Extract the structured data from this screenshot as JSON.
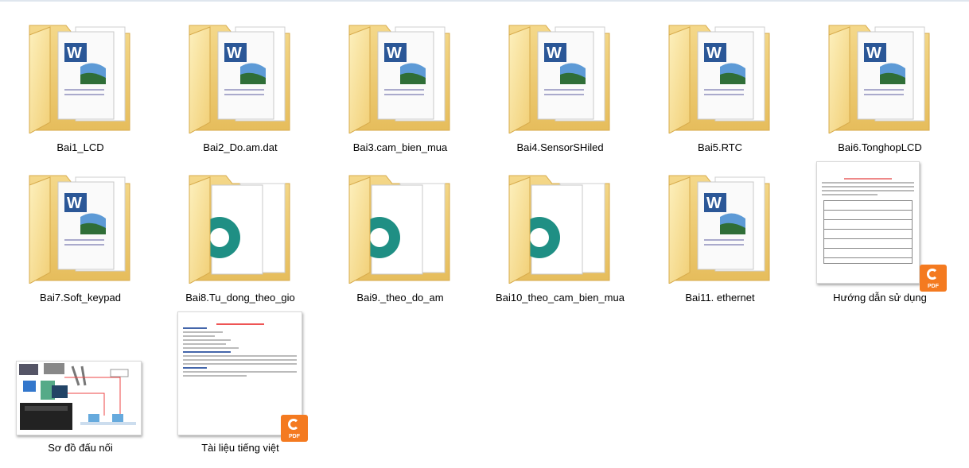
{
  "items": [
    {
      "label": "Bai1_LCD",
      "icon": "folder-word-icon"
    },
    {
      "label": "Bai2_Do.am.dat",
      "icon": "folder-word-icon"
    },
    {
      "label": "Bai3.cam_bien_mua",
      "icon": "folder-word-icon"
    },
    {
      "label": "Bai4.SensorSHiled",
      "icon": "folder-word-icon"
    },
    {
      "label": "Bai5.RTC",
      "icon": "folder-word-icon"
    },
    {
      "label": "Bai6.TonghopLCD",
      "icon": "folder-word-icon"
    },
    {
      "label": "Bai7.Soft_keypad",
      "icon": "folder-word-icon"
    },
    {
      "label": "Bai8.Tu_dong_theo_gio",
      "icon": "folder-arduino-icon"
    },
    {
      "label": "Bai9._theo_do_am",
      "icon": "folder-arduino-icon"
    },
    {
      "label": "Bai10_theo_cam_bien_mua",
      "icon": "folder-arduino-icon"
    },
    {
      "label": "Bai11. ethernet",
      "icon": "folder-word-icon"
    },
    {
      "label": "Hướng dẫn sử dụng",
      "icon": "pdf-thumbnail-icon"
    },
    {
      "label": "Sơ đồ đấu nối",
      "icon": "image-thumbnail-icon"
    },
    {
      "label": "Tài liệu tiếng việt",
      "icon": "pdf-thumbnail-icon"
    }
  ],
  "pdf_badge_text": "PDF"
}
